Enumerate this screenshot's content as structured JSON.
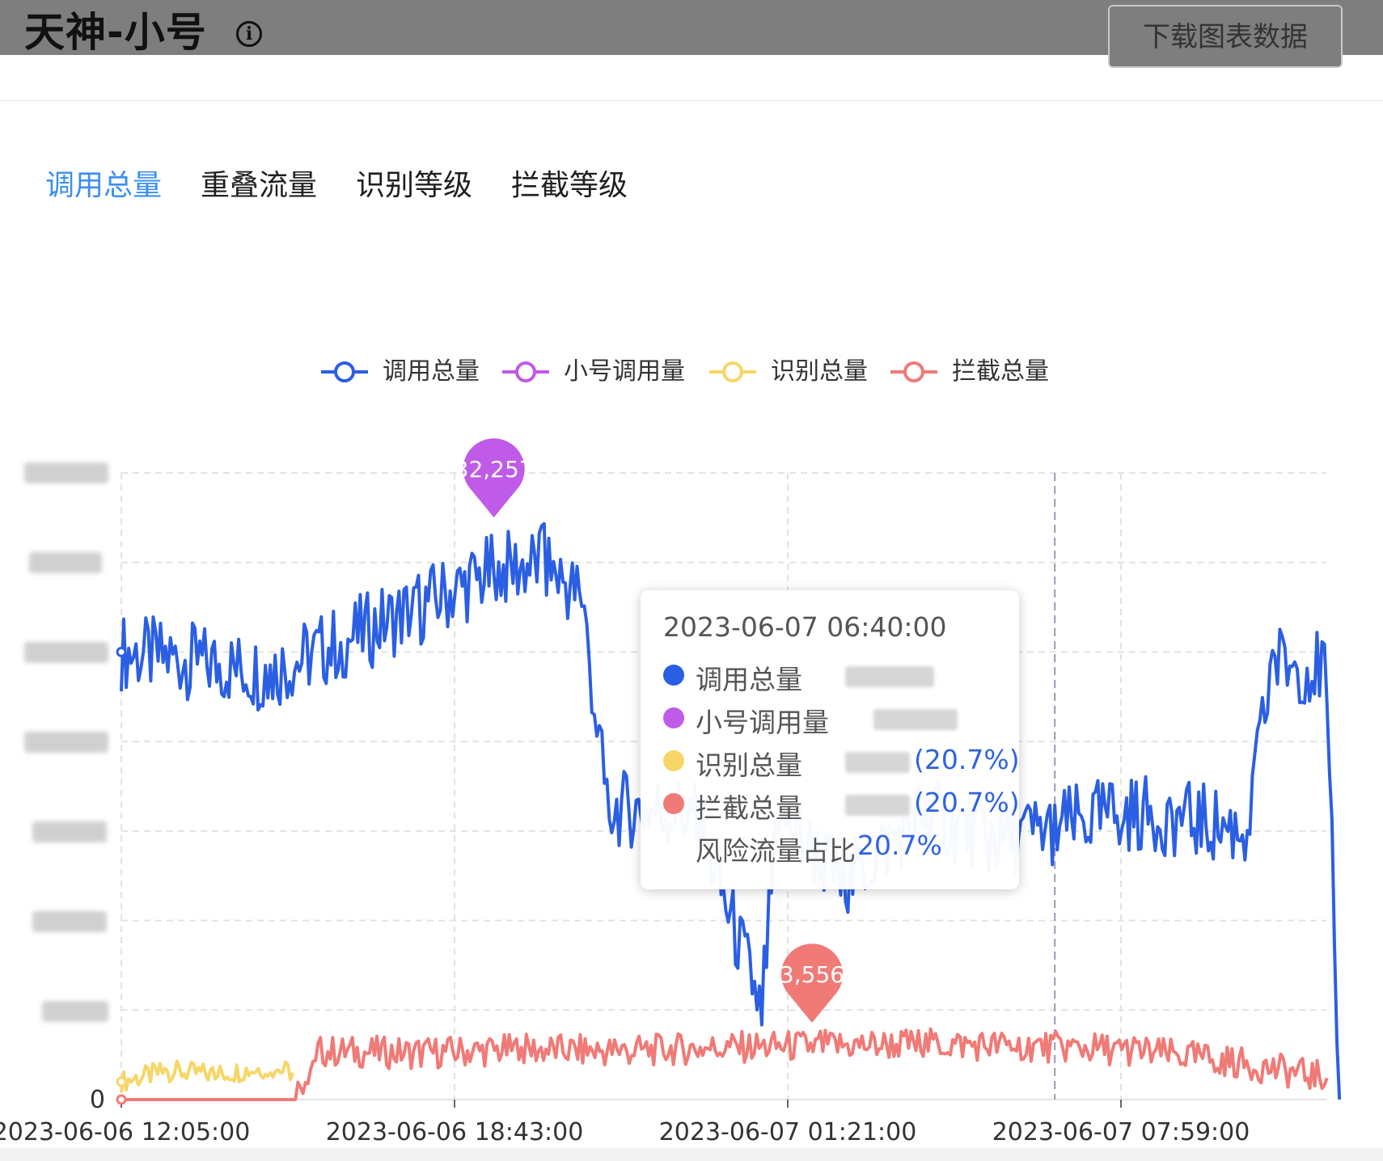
{
  "header": {
    "title": "天神-小号",
    "info_icon": "info-circle-icon",
    "download_label": "下载图表数据"
  },
  "tabs": [
    {
      "label": "调用总量",
      "active": true
    },
    {
      "label": "重叠流量",
      "active": false
    },
    {
      "label": "识别等级",
      "active": false
    },
    {
      "label": "拦截等级",
      "active": false
    }
  ],
  "colors": {
    "total": "#2b5fe3",
    "small": "#c05ae8",
    "identify": "#f7d667",
    "intercept": "#f07a76",
    "active_tab": "#3b8ff0"
  },
  "chart_data": {
    "type": "line",
    "xlabel": "",
    "ylabel": "",
    "x_ticks": [
      "2023-06-06 12:05:00",
      "2023-06-06 18:43:00",
      "2023-06-07 01:21:00",
      "2023-06-07 07:59:00"
    ],
    "y_ticks_visible": [
      "0"
    ],
    "ylim": [
      0,
      35000
    ],
    "series": [
      {
        "name": "调用总量",
        "key": "total",
        "x": [
          "2023-06-06 12:05:00",
          "2023-06-06 13:30:00",
          "2023-06-06 15:00:00",
          "2023-06-06 16:30:00",
          "2023-06-06 18:00:00",
          "2023-06-06 19:30:00",
          "2023-06-06 20:30:00",
          "2023-06-06 21:15:00",
          "2023-06-06 21:45:00",
          "2023-06-06 23:30:00",
          "2023-06-07 00:50:00",
          "2023-06-07 01:10:00",
          "2023-06-07 02:30:00",
          "2023-06-07 04:00:00",
          "2023-06-07 05:30:00",
          "2023-06-07 06:40:00",
          "2023-06-07 08:00:00",
          "2023-06-07 09:00:00",
          "2023-06-07 10:30:00",
          "2023-06-07 11:00:00",
          "2023-06-07 12:05:00",
          "2023-06-07 12:20:00"
        ],
        "y": [
          25000,
          24500,
          23800,
          25600,
          27500,
          29500,
          30000,
          28000,
          16300,
          16000,
          5000,
          16000,
          12000,
          16000,
          14500,
          15200,
          16000,
          15800,
          15000,
          24500,
          24000,
          0
        ]
      },
      {
        "name": "小号调用量",
        "key": "small",
        "x": [],
        "y": []
      },
      {
        "name": "识别总量",
        "key": "identify",
        "x": [
          "2023-06-06 12:05:00",
          "2023-06-06 13:00:00",
          "2023-06-06 14:00:00",
          "2023-06-06 15:00:00",
          "2023-06-06 15:30:00"
        ],
        "y": [
          1000,
          1600,
          1400,
          1800,
          1500
        ]
      },
      {
        "name": "拦截总量",
        "key": "intercept",
        "x": [
          "2023-06-06 12:05:00",
          "2023-06-06 15:30:00",
          "2023-06-06 16:00:00",
          "2023-06-06 18:00:00",
          "2023-06-06 20:00:00",
          "2023-06-06 22:00:00",
          "2023-06-07 00:00:00",
          "2023-06-07 02:00:00",
          "2023-06-07 04:00:00",
          "2023-06-07 06:00:00",
          "2023-06-07 08:00:00",
          "2023-06-07 10:00:00",
          "2023-06-07 12:05:00"
        ],
        "y": [
          0,
          0,
          2700,
          2600,
          2800,
          2700,
          2900,
          3000,
          3100,
          3000,
          2800,
          2200,
          1200
        ]
      }
    ],
    "markers": [
      {
        "series": "小号调用量",
        "label": "32,257",
        "x": "2023-06-06 19:30:00",
        "y": 32257
      },
      {
        "series": "拦截总量",
        "label": "3,556",
        "x": "2023-06-07 01:50:00",
        "y": 3556
      }
    ],
    "tooltip": {
      "time": "2023-06-07 06:40:00",
      "rows": [
        {
          "name": "调用总量",
          "key": "total",
          "pct": ""
        },
        {
          "name": "小号调用量",
          "key": "small",
          "pct": ""
        },
        {
          "name": "识别总量",
          "key": "identify",
          "pct": "(20.7%)"
        },
        {
          "name": "拦截总量",
          "key": "intercept",
          "pct": "(20.7%)"
        }
      ],
      "risk_label": "风险流量占比",
      "risk_value": "20.7%"
    },
    "grid": true,
    "legend_position": "top-center"
  }
}
